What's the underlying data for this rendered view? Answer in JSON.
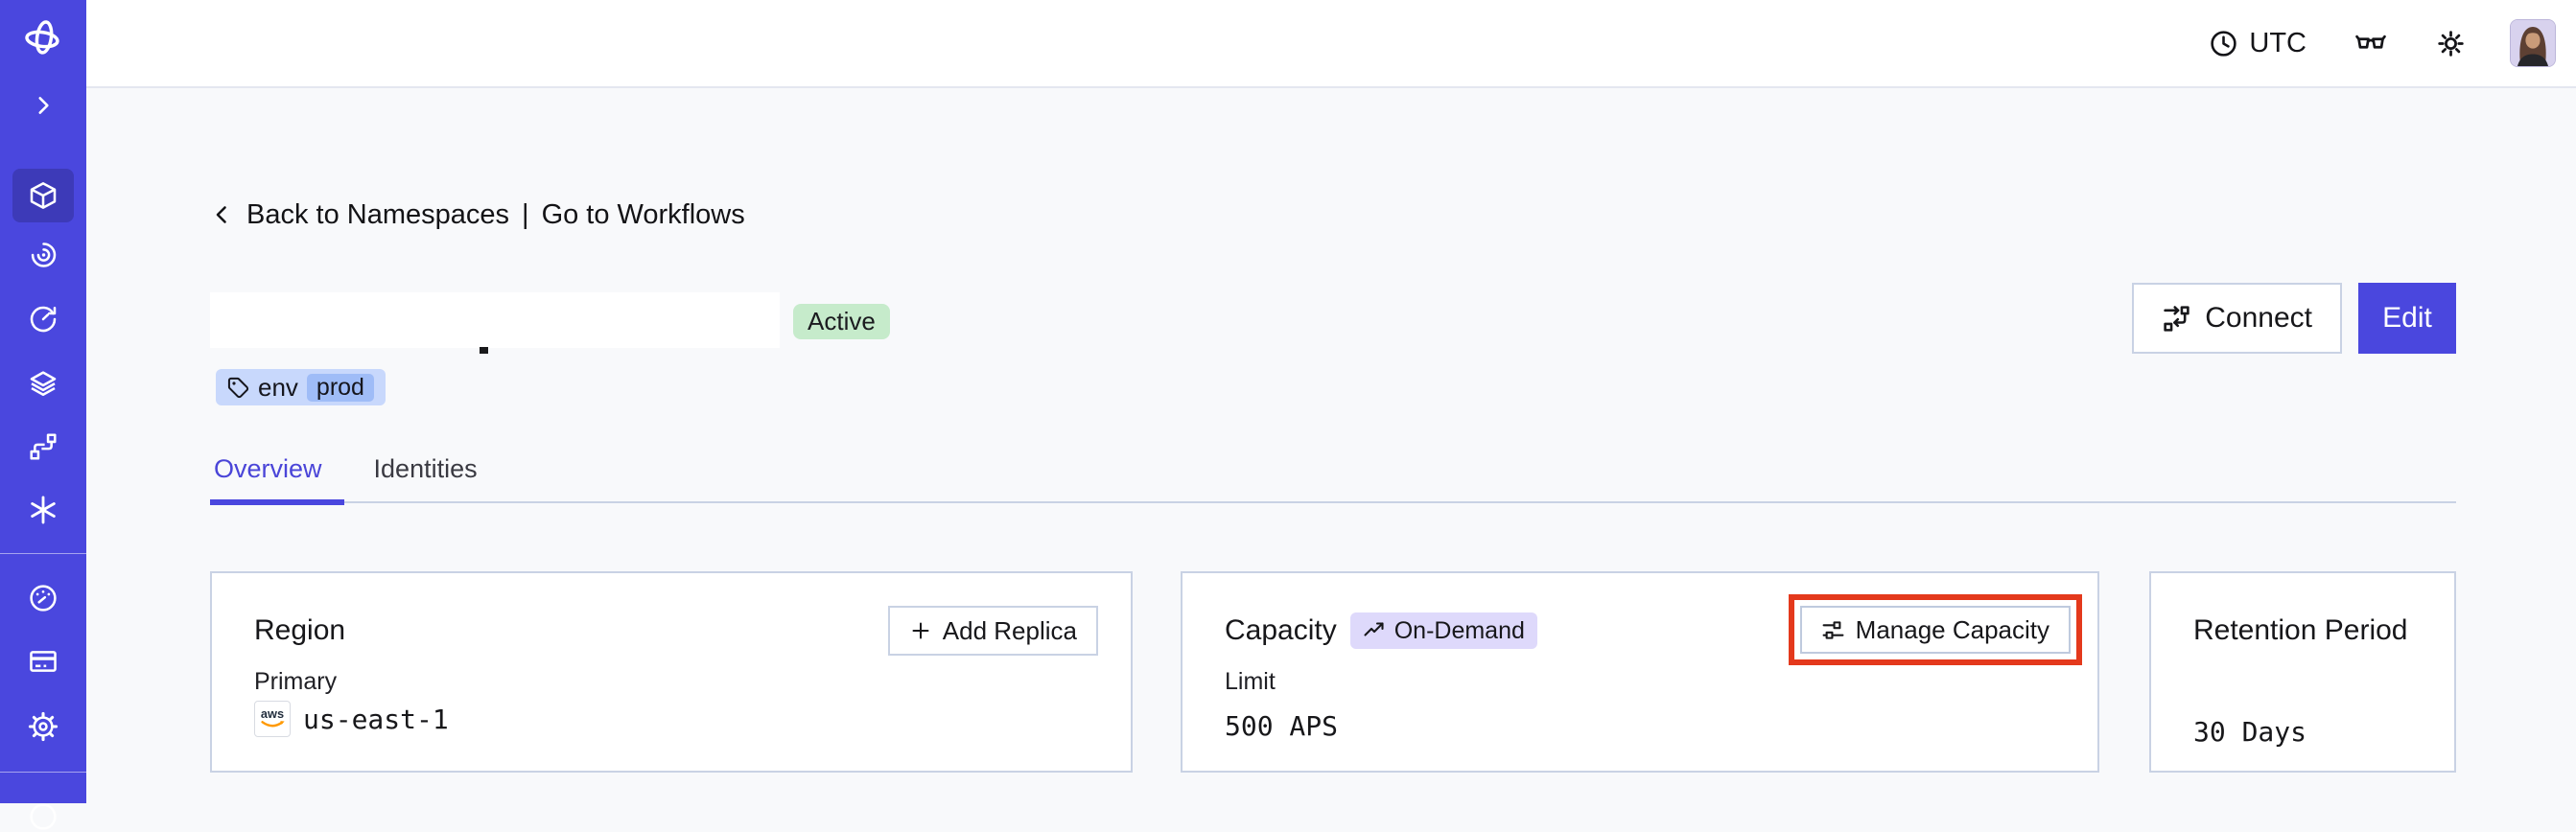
{
  "topbar": {
    "timezone": "UTC",
    "icons": [
      "clock-icon",
      "glasses-icon",
      "sun-icon",
      "avatar"
    ]
  },
  "sidebar": {
    "icons": [
      "temporal-logo",
      "expand-chevron",
      "namespaces",
      "workflows",
      "schedules",
      "deployments",
      "batch-operations",
      "nexus",
      "usage",
      "billing",
      "settings",
      "help"
    ],
    "active_item": "namespaces"
  },
  "breadcrumb": {
    "back": "Back to Namespaces",
    "separator": "|",
    "go": "Go to Workflows"
  },
  "header": {
    "status": "Active",
    "tag_key": "env",
    "tag_value": "prod"
  },
  "actions": {
    "connect": "Connect",
    "edit": "Edit"
  },
  "tabs": [
    {
      "label": "Overview",
      "active": true
    },
    {
      "label": "Identities",
      "active": false
    }
  ],
  "cards": {
    "region": {
      "title": "Region",
      "add_replica": "Add Replica",
      "primary_label": "Primary",
      "provider": "aws",
      "value": "us-east-1"
    },
    "capacity": {
      "title": "Capacity",
      "badge": "On-Demand",
      "manage": "Manage Capacity",
      "limit_label": "Limit",
      "value": "500 APS"
    },
    "retention": {
      "title": "Retention Period",
      "value": "30 Days"
    }
  },
  "colors": {
    "accent_indigo": "#4a47de",
    "sidebar_active": "#3d3ab8",
    "card_border": "#c9d2e4",
    "status_green_bg": "#c6ebcb",
    "tag_blue_bg": "#c8d8fc",
    "tag_blue_inner": "#9fbcf7",
    "capacity_badge_bg": "#ded9fb",
    "highlight_red": "#e4391c",
    "aws_orange": "#ff9900",
    "page_bg": "#f8f9fb"
  }
}
